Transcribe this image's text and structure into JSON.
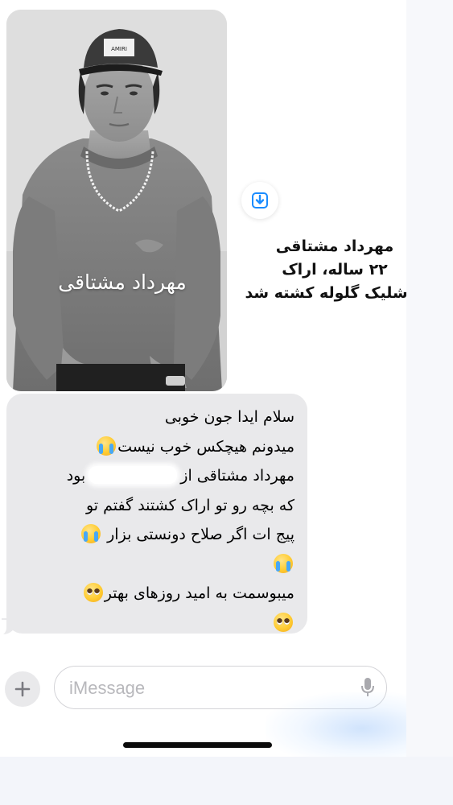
{
  "photo": {
    "caption": "مهرداد مشتاقی",
    "cap_text": "AMIRI"
  },
  "side_caption": {
    "lines": [
      "مهرداد مشتاقی",
      "۲۲ ساله، اراک",
      "با شلیک گلوله کشته شد"
    ]
  },
  "message": {
    "line1": "سلام ایدا جون خوبی",
    "line2": "میدونم هیچکس خوب نیست",
    "line3_a": "مهرداد مشتاقی از",
    "line3_b": "بود",
    "line4": "که بچه رو تو اراک کشتند گفتم تو",
    "line5": "پیج ات اگر صلاح دونستی بزار",
    "line7": "میبوسمت به امید روزهای بهتر",
    "emojis": [
      "loudly-crying-face",
      "pleading-face"
    ]
  },
  "composer": {
    "placeholder": "iMessage"
  },
  "icons": {
    "save": "download-icon",
    "plus": "plus-icon",
    "mic": "microphone-icon"
  },
  "colors": {
    "accent": "#1a8cff",
    "bubble": "#e9e9eb"
  }
}
